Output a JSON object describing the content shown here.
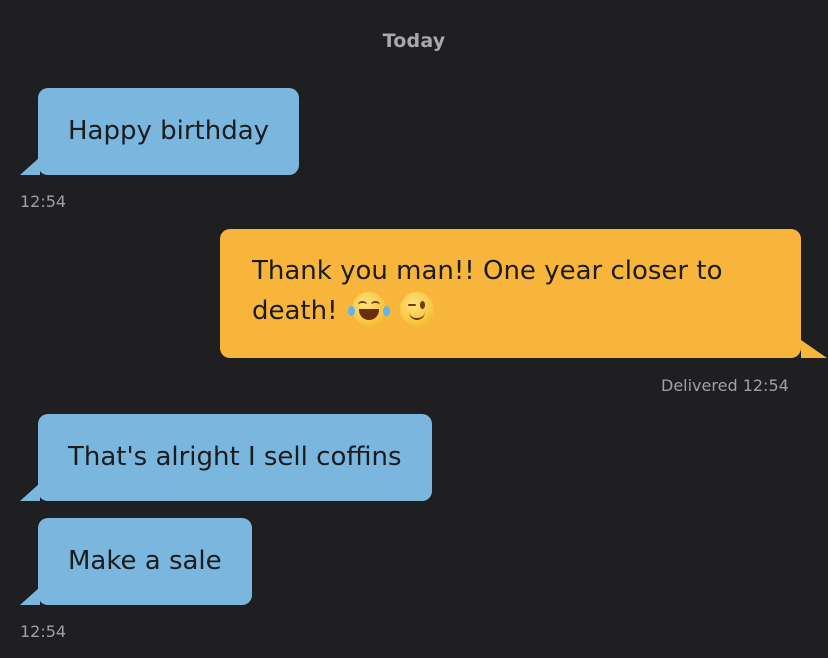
{
  "day_separator": "Today",
  "messages": [
    {
      "direction": "incoming",
      "text": "Happy birthday",
      "time": "12:54"
    },
    {
      "direction": "outgoing",
      "text": "Thank you man!! One year closer to death!",
      "emojis": [
        "face-with-tears-of-joy",
        "winking-face"
      ],
      "status": "Delivered",
      "time": "12:54"
    },
    {
      "direction": "incoming",
      "text": "That's alright I sell coffins"
    },
    {
      "direction": "incoming",
      "text": "Make a sale",
      "time": "12:54"
    }
  ],
  "colors": {
    "background": "#1f1f21",
    "incoming_bubble": "#7ab6dd",
    "outgoing_bubble": "#f8b53c",
    "meta_text": "#a0a0a4"
  }
}
